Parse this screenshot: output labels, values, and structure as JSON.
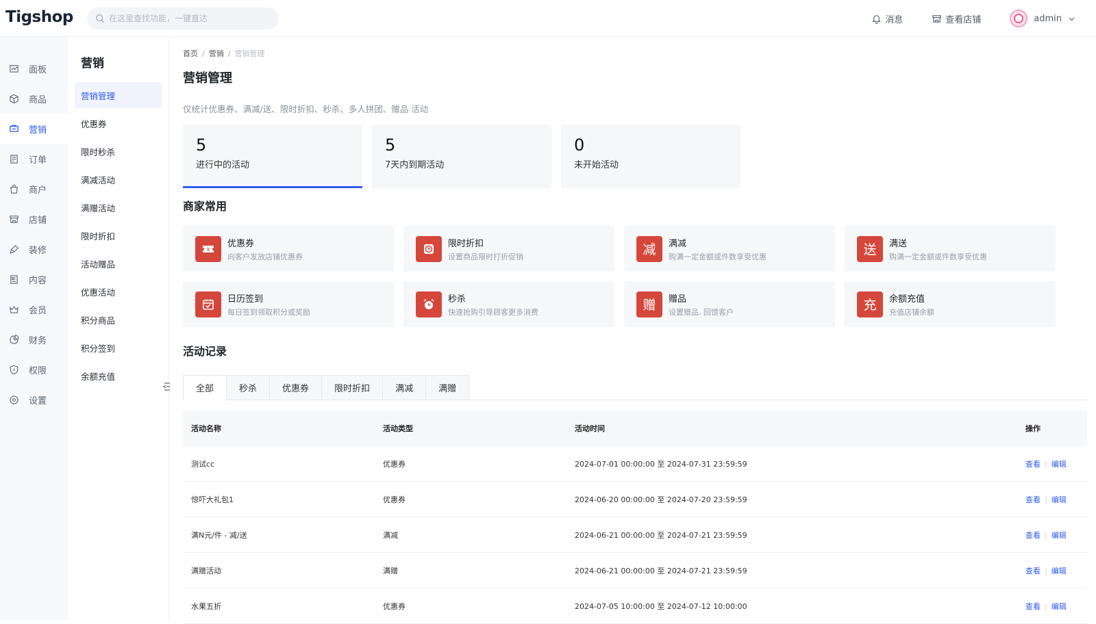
{
  "app": {
    "logo": "Tigshop"
  },
  "search": {
    "placeholder": "在这里查找功能，一键直达"
  },
  "top_actions": {
    "messages": "消息",
    "view_store": "查看店铺",
    "user": "admin"
  },
  "rail": [
    {
      "label": "面板",
      "icon": "chart-icon"
    },
    {
      "label": "商品",
      "icon": "box-icon"
    },
    {
      "label": "营销",
      "icon": "marketing-icon",
      "active": true
    },
    {
      "label": "订单",
      "icon": "order-icon"
    },
    {
      "label": "商户",
      "icon": "bag-icon"
    },
    {
      "label": "店铺",
      "icon": "store-icon"
    },
    {
      "label": "装修",
      "icon": "brush-icon"
    },
    {
      "label": "内容",
      "icon": "content-icon"
    },
    {
      "label": "会员",
      "icon": "crown-icon"
    },
    {
      "label": "财务",
      "icon": "pie-icon"
    },
    {
      "label": "权限",
      "icon": "shield-icon"
    },
    {
      "label": "设置",
      "icon": "settings-icon"
    }
  ],
  "subnav": {
    "title": "营销",
    "items": [
      "营销管理",
      "优惠券",
      "限时秒杀",
      "满减活动",
      "满赠活动",
      "限时折扣",
      "活动赠品",
      "优惠活动",
      "积分商品",
      "积分签到",
      "余额充值"
    ]
  },
  "breadcrumb": [
    "首页",
    "营销",
    "营销管理"
  ],
  "page_title": "营销管理",
  "description": "仅统计优惠券、满减/送、限时折扣、秒杀、多人拼团、赠品 活动",
  "stats": [
    {
      "value": "5",
      "label": "进行中的活动"
    },
    {
      "value": "5",
      "label": "7天内到期活动"
    },
    {
      "value": "0",
      "label": "未开始活动"
    }
  ],
  "common_title": "商家常用",
  "tools": [
    {
      "name": "优惠券",
      "desc": "向客户发放店铺优惠券",
      "glyph": "",
      "icon": "ticket-icon"
    },
    {
      "name": "限时折扣",
      "desc": "设置商品限时打折促销",
      "glyph": "",
      "icon": "clock-icon"
    },
    {
      "name": "满减",
      "desc": "购满一定金额或件数享受优惠",
      "glyph": "减",
      "icon": "reduce-icon"
    },
    {
      "name": "满送",
      "desc": "购满一定金额或件数享受优惠",
      "glyph": "送",
      "icon": "send-icon"
    },
    {
      "name": "日历签到",
      "desc": "每日签到领取积分或奖励",
      "glyph": "",
      "icon": "calendar-icon"
    },
    {
      "name": "秒杀",
      "desc": "快速抢购引导顾客更多消费",
      "glyph": "",
      "icon": "alarm-icon"
    },
    {
      "name": "赠品",
      "desc": "设置赠品, 回馈客户",
      "glyph": "赠",
      "icon": "gift-icon"
    },
    {
      "name": "余额充值",
      "desc": "充值店铺余额",
      "glyph": "充",
      "icon": "recharge-icon"
    }
  ],
  "records_title": "活动记录",
  "tabs": [
    "全部",
    "秒杀",
    "优惠券",
    "限时折扣",
    "满减",
    "满赠"
  ],
  "table": {
    "headers": [
      "活动名称",
      "活动类型",
      "活动时间",
      "操作"
    ],
    "rows": [
      {
        "name": "测试cc",
        "type": "优惠券",
        "time": "2024-07-01 00:00:00 至 2024-07-31 23:59:59"
      },
      {
        "name": "惊吓大礼包1",
        "type": "优惠券",
        "time": "2024-06-20 00:00:00 至 2024-07-20 23:59:59"
      },
      {
        "name": "满N元/件 - 减/送",
        "type": "满减",
        "time": "2024-06-21 00:00:00 至 2024-07-21 23:59:59"
      },
      {
        "name": "满赠活动",
        "type": "满赠",
        "time": "2024-06-21 00:00:00 至 2024-07-21 23:59:59"
      },
      {
        "name": "水果五折",
        "type": "优惠券",
        "time": "2024-07-05 10:00:00 至 2024-07-12 10:00:00"
      }
    ],
    "actions": {
      "view": "查看",
      "edit": "编辑"
    }
  },
  "colors": {
    "accent": "#2f5cf0",
    "tool_icon": "#d5473b"
  }
}
